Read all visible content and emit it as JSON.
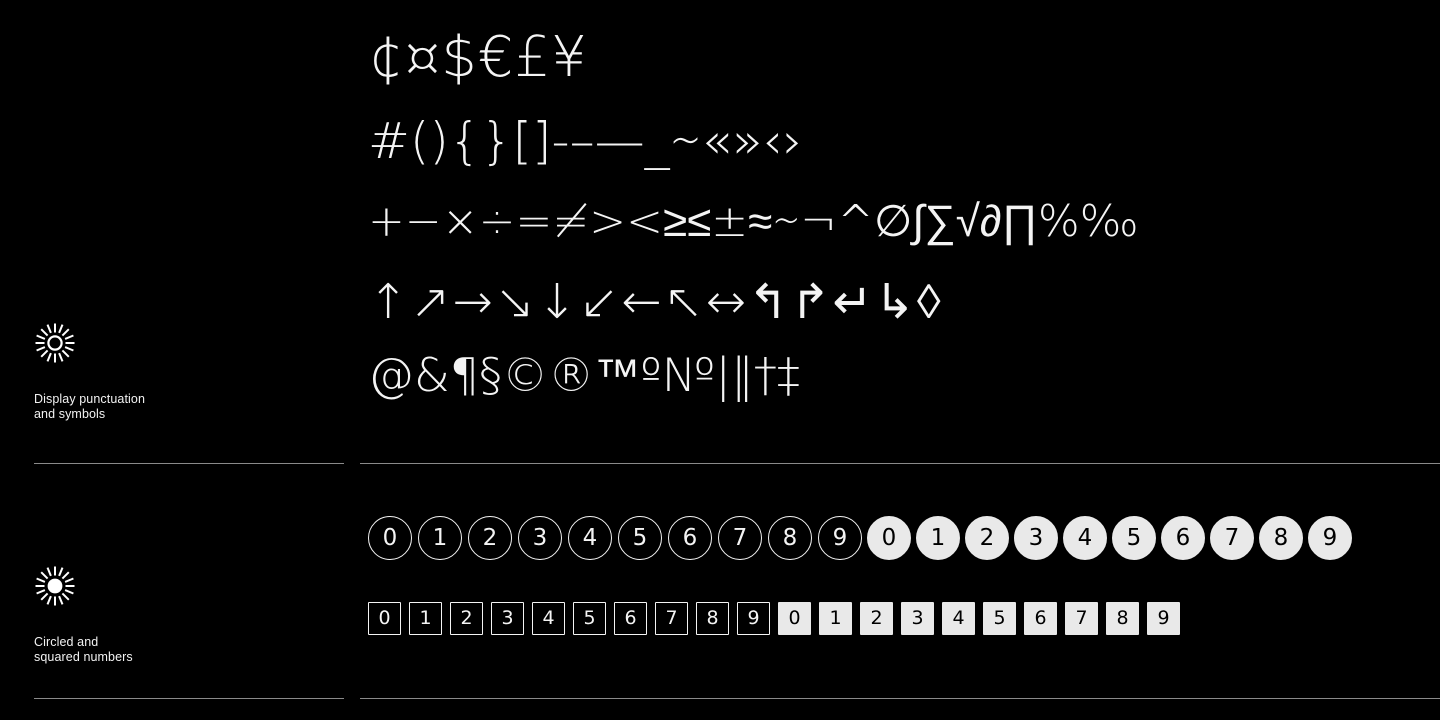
{
  "page": {
    "background_color": "#000000",
    "foreground_color": "#f4f4f4",
    "fill_color": "#e9e9e9",
    "divider_color": "#8a8a8a"
  },
  "sections": [
    {
      "id": "display-punctuation",
      "icon": "sun-outline-icon",
      "label_line1": "Display punctuation",
      "label_line2": "and symbols",
      "rows": [
        {
          "id": "currency",
          "glyphs": "¢¤$€£¥"
        },
        {
          "id": "punctuation",
          "glyphs": "#(){}[]-–—_∼«»‹›"
        },
        {
          "id": "math",
          "glyphs": "+−×÷=≠><≥≤±≈∼¬^∅∫∑√∂∏%‰"
        },
        {
          "id": "arrows",
          "glyphs": "↑↗→↘↓↙←↖↔↰↱↵↳◊"
        },
        {
          "id": "reference",
          "glyphs": "@&¶§©®™º№|‖†‡"
        }
      ]
    },
    {
      "id": "circled-squared-numbers",
      "icon": "sun-filled-icon",
      "label_line1": "Circled and",
      "label_line2": "squared numbers",
      "circled_outline": [
        "0",
        "1",
        "2",
        "3",
        "4",
        "5",
        "6",
        "7",
        "8",
        "9"
      ],
      "circled_filled": [
        "0",
        "1",
        "2",
        "3",
        "4",
        "5",
        "6",
        "7",
        "8",
        "9"
      ],
      "squared_outline": [
        "0",
        "1",
        "2",
        "3",
        "4",
        "5",
        "6",
        "7",
        "8",
        "9"
      ],
      "squared_filled": [
        "0",
        "1",
        "2",
        "3",
        "4",
        "5",
        "6",
        "7",
        "8",
        "9"
      ]
    }
  ]
}
